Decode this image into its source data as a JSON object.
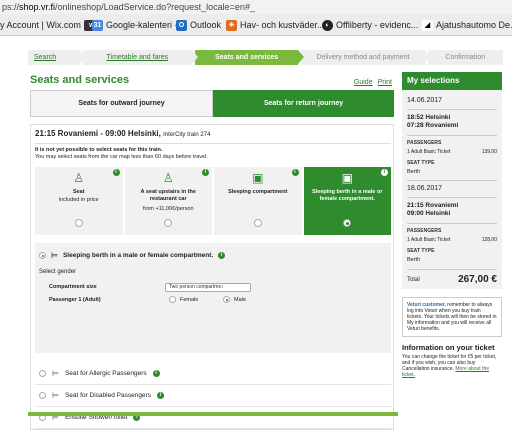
{
  "browser": {
    "url_scheme": "ps://",
    "url_host": "shop.vr.fi",
    "url_path": "/onlineshop/LoadService.do?request_locale=en#_",
    "bookmarks": [
      {
        "label": "y Account | Wix.com",
        "icon": "wix-icon"
      },
      {
        "label": "Google-kalenteri -...",
        "icon": "calendar-icon"
      },
      {
        "label": "Outlook",
        "icon": "outlook-icon"
      },
      {
        "label": "Hav- och kustväder...",
        "icon": "weather-icon"
      },
      {
        "label": "Offliberty - evidenc...",
        "icon": "offliberty-icon"
      },
      {
        "label": "Ajatushautomo De...",
        "icon": "ajatus-icon"
      }
    ]
  },
  "steps": [
    "Search",
    "Timetable and fares",
    "Seats and services",
    "Delivery method and payment",
    "Confirmation"
  ],
  "page": {
    "title": "Seats and services",
    "guide": "Guide",
    "print": "Print",
    "tab_outward": "Seats for outward journey",
    "tab_return": "Seats for return journey"
  },
  "train": {
    "header": "21:15 Rovaniemi  -  09:00 Helsinki,",
    "train_no": "InterCity train 274",
    "notice_bold": "It is not yet possible to select seats for this train.",
    "notice": "You may select seats from the car map less than 60 days before travel."
  },
  "cars": [
    {
      "icon": "seat-icon",
      "title": "Seat",
      "sub": "included in price",
      "sub2": ""
    },
    {
      "icon": "restaurant-seat-icon",
      "title": "A seat upstairs in the restaurant car",
      "sub": "",
      "sub2": "from  +11,00€/person"
    },
    {
      "icon": "compartment-icon",
      "title": "Sleeping compartment",
      "sub": "",
      "sub2": ""
    },
    {
      "icon": "berth-icon",
      "title": "Sleeping berth in a male or female compartment.",
      "sub": "",
      "sub2": ""
    }
  ],
  "selected": {
    "title": "Sleeping berth in a male or female compartment.",
    "gender_label": "Select gender",
    "size_label": "Compartment size",
    "size_value": "Two person compartme↕",
    "passenger": "Passenger 1  (Adult)",
    "female": "Female",
    "male": "Male"
  },
  "extras": [
    "Seat for Allergic Passengers",
    "Seat for Disabled Passengers",
    "Ensuite Shower/Toilet"
  ],
  "sidebar": {
    "title": "My selections",
    "trips": [
      {
        "date": "14.06.2017",
        "route1": "18:52 Helsinki",
        "route2": "07:28 Rovaniemi",
        "passengers_label": "PASSENGERS",
        "ticket": "1 Adult Basic Ticket",
        "price": "139,00",
        "seat_label": "SEAT TYPE",
        "seat": "Berth"
      },
      {
        "date": "18.06.2017",
        "route1": "21:15 Rovaniemi",
        "route2": "09:00 Helsinki",
        "passengers_label": "PASSENGERS",
        "ticket": "1 Adult Basic Ticket",
        "price": "128,00",
        "seat_label": "SEAT TYPE",
        "seat": "Berth"
      }
    ],
    "total_label": "Total",
    "total_value": "267,00 €",
    "veturi_bold": "Veturi customer,",
    "veturi_text": " remember to always log into Veturi when you buy train tickets. Your tickets will then be stored in My information and you will receive all Veturi benefits.",
    "info_title": "Information on your ticket",
    "info_text": "You can change the ticket for €5 per ticket, and if you wish, you can also buy Cancellation insurance.",
    "info_more": "More about the ticket."
  },
  "colors": {
    "brand_green": "#2e8b2e",
    "light_green": "#7ab93e"
  }
}
